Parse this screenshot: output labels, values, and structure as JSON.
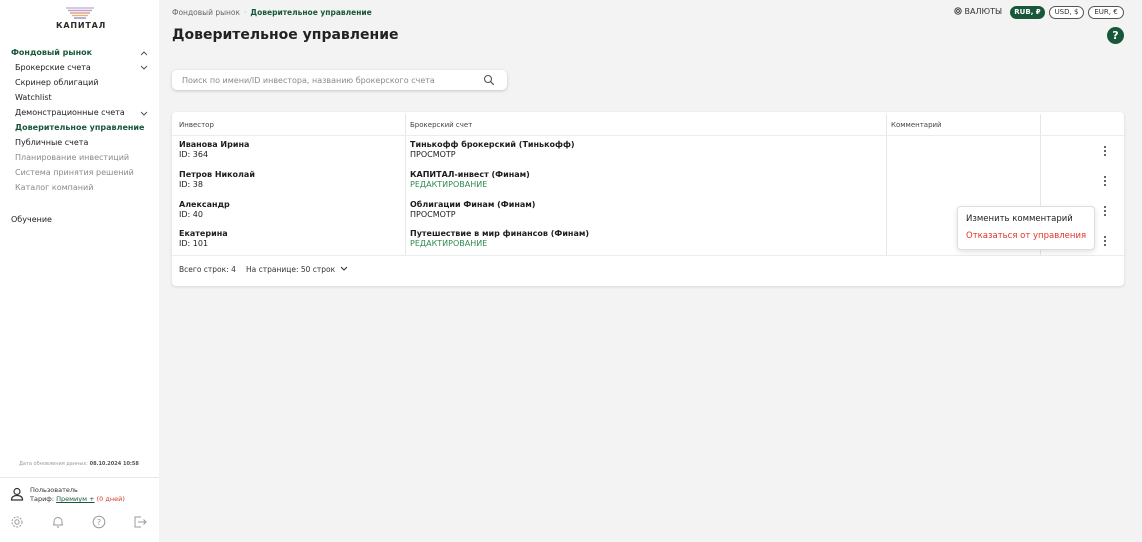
{
  "brand": {
    "name": "КАПИТАЛ"
  },
  "sidebar": {
    "items": [
      {
        "label": "Фондовый рынок"
      },
      {
        "label": "Брокерские счета"
      },
      {
        "label": "Скринер облигаций"
      },
      {
        "label": "Watchlist"
      },
      {
        "label": "Демонстрационные счета"
      },
      {
        "label": "Доверительное управление"
      },
      {
        "label": "Публичные счета"
      },
      {
        "label": "Планирование инвестиций"
      },
      {
        "label": "Система принятия решений"
      },
      {
        "label": "Каталог компаний"
      },
      {
        "label": "Обучение"
      }
    ],
    "updated_label": "Дата обновления данных:",
    "updated_value": "08.10.2024 10:58",
    "user": {
      "name": "Пользователь",
      "tariff_label": "Тариф:",
      "plan": "Премиум +",
      "days": "(0 дней)"
    },
    "bottom_icons": [
      "settings-icon",
      "bell-icon",
      "help-circle-icon",
      "logout-icon"
    ]
  },
  "breadcrumb": {
    "root": "Фондовый рынок",
    "separator": "·",
    "current": "Доверительное управление"
  },
  "page_title": "Доверительное управление",
  "currencies": {
    "label": "ВАЛЮТЫ",
    "options": [
      {
        "label": "RUB, ₽",
        "active": true
      },
      {
        "label": "USD, $",
        "active": false
      },
      {
        "label": "EUR, €",
        "active": false
      }
    ]
  },
  "help_label": "?",
  "search": {
    "placeholder": "Поиск по имени/ID инвестора, названию брокерского счета",
    "value": ""
  },
  "table": {
    "columns": [
      "Инвестор",
      "Брокерский счет",
      "Комментарий"
    ],
    "rows": [
      {
        "name": "Иванова Ирина",
        "id": "ID: 364",
        "account": "Тинькофф брокерский (Тинькофф)",
        "mode": "ПРОСМОТР",
        "comment": ""
      },
      {
        "name": "Петров Николай",
        "id": "ID: 38",
        "account": "КАПИТАЛ-инвест (Финам)",
        "mode": "РЕДАКТИРОВАНИЕ",
        "comment": ""
      },
      {
        "name": "Александр",
        "id": "ID: 40",
        "account": "Облигации Финам (Финам)",
        "mode": "ПРОСМОТР",
        "comment": ""
      },
      {
        "name": "Екатерина",
        "id": "ID: 101",
        "account": "Путешествие в мир финансов (Финам)",
        "mode": "РЕДАКТИРОВАНИЕ",
        "comment": ""
      }
    ],
    "total": "Всего строк: 4",
    "per_page": "На странице: 50 строк"
  },
  "context_menu": {
    "items": [
      "Изменить комментарий",
      "Отказаться от управления"
    ]
  },
  "colors": {
    "accent": "#19573a",
    "edit_mode": "#2f8a52",
    "danger": "#e0352b"
  }
}
